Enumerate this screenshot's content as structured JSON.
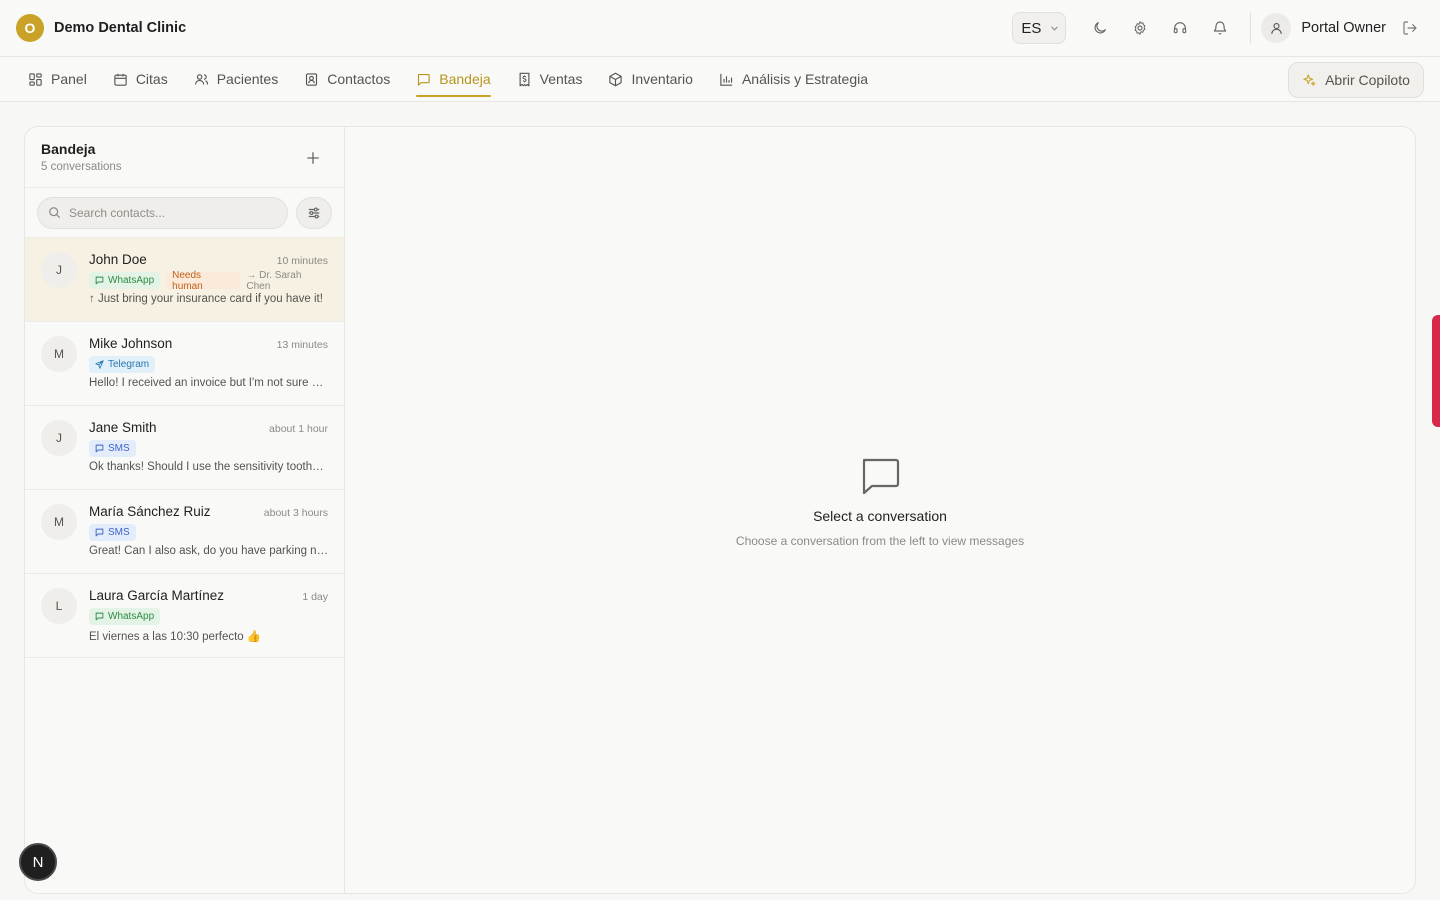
{
  "app": {
    "logo_letter": "O",
    "name": "Demo Dental Clinic",
    "accent": "#c9a227"
  },
  "topbar": {
    "language": "ES",
    "icons": [
      "moon-icon",
      "gear-icon",
      "headset-icon",
      "bell-icon"
    ],
    "user_name": "Portal Owner"
  },
  "nav": {
    "items": [
      {
        "label": "Panel",
        "icon": "layout-grid-icon"
      },
      {
        "label": "Citas",
        "icon": "calendar-icon"
      },
      {
        "label": "Pacientes",
        "icon": "users-icon"
      },
      {
        "label": "Contactos",
        "icon": "contact-icon"
      },
      {
        "label": "Bandeja",
        "icon": "message-square-icon",
        "active": true
      },
      {
        "label": "Ventas",
        "icon": "receipt-icon"
      },
      {
        "label": "Inventario",
        "icon": "package-icon"
      },
      {
        "label": "Análisis y Estrategia",
        "icon": "bar-chart-icon"
      }
    ],
    "copilot_label": "Abrir Copiloto"
  },
  "inbox": {
    "title": "Bandeja",
    "count_label": "5 conversations",
    "search_placeholder": "Search contacts...",
    "conversations": [
      {
        "initial": "J",
        "name": "John Doe",
        "time": "10 minutes",
        "channel": "WhatsApp",
        "badge": "Needs human",
        "assignee": "→ Dr. Sarah Chen",
        "preview": "↑ Just bring your insurance card if you have it!",
        "selected": true
      },
      {
        "initial": "M",
        "name": "Mike Johnson",
        "time": "13 minutes",
        "channel": "Telegram",
        "preview": "Hello! I received an invoice but I'm not sure about it"
      },
      {
        "initial": "J",
        "name": "Jane Smith",
        "time": "about 1 hour",
        "channel": "SMS",
        "preview": "Ok thanks! Should I use the sensitivity toothpaste?"
      },
      {
        "initial": "M",
        "name": "María Sánchez Ruiz",
        "time": "about 3 hours",
        "channel": "SMS",
        "preview": "Great! Can I also ask, do you have parking nearby?"
      },
      {
        "initial": "L",
        "name": "Laura García Martínez",
        "time": "1 day",
        "channel": "WhatsApp",
        "preview": "El viernes a las 10:30 perfecto 👍"
      }
    ]
  },
  "empty_state": {
    "title": "Select a conversation",
    "subtitle": "Choose a conversation from the left to view messages"
  },
  "dev_badge": "N"
}
